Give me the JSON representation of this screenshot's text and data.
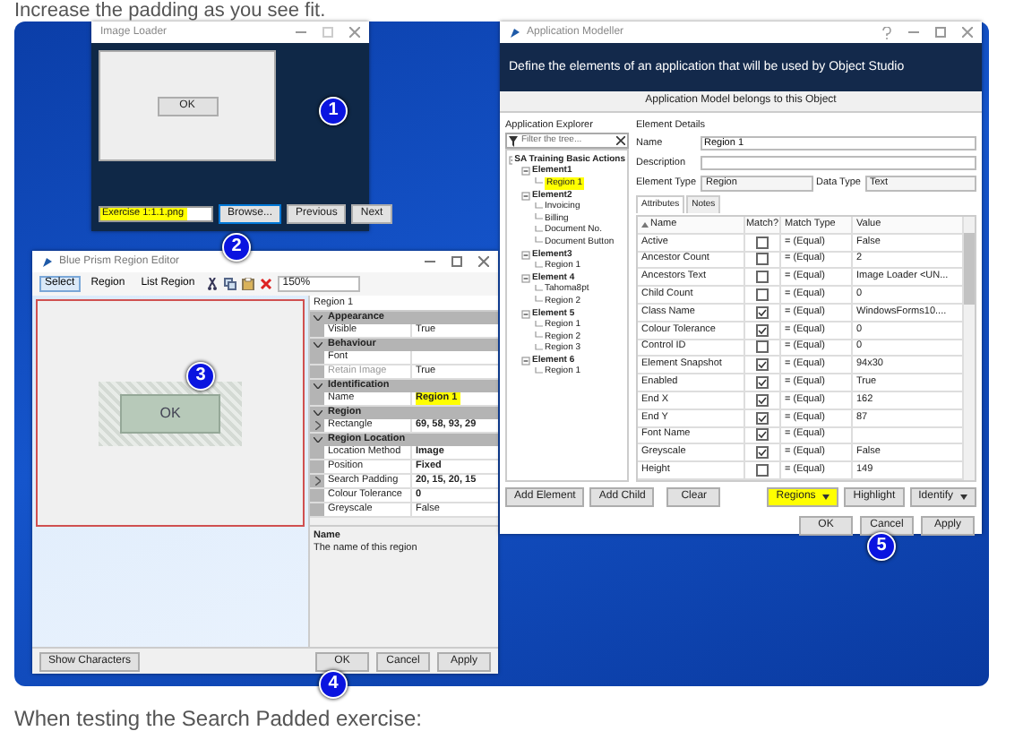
{
  "intro": "Increase the padding as you see fit.",
  "image_loader": {
    "title": "Image Loader",
    "preview_button": "OK",
    "file_field": {
      "value": "Exercise 1:1.1.png",
      "highlighted": true
    },
    "buttons": [
      {
        "label": "Browse...",
        "focused": true
      },
      {
        "label": "Previous",
        "focused": false
      },
      {
        "label": "Next",
        "focused": false
      }
    ]
  },
  "region_editor": {
    "title": "Blue Prism Region Editor",
    "toolbar": [
      {
        "label": "Select",
        "selected": true
      },
      {
        "label": "Region",
        "selected": false
      },
      {
        "label": "List Region",
        "selected": false
      }
    ],
    "zoom": "150%",
    "canvas_button": "OK",
    "object_select": "Region 1",
    "properties": [
      {
        "category": "Appearance",
        "rows": [
          {
            "name": "Visible",
            "value": "True",
            "bold": false,
            "highlighted": false,
            "disabled": false,
            "expandable": false
          }
        ]
      },
      {
        "category": "Behaviour",
        "rows": [
          {
            "name": "Font",
            "disabled": false,
            "expandable": false
          },
          {
            "name": "Retain Image",
            "value": "True",
            "bold": false,
            "highlighted": false,
            "disabled": true,
            "expandable": false
          }
        ]
      },
      {
        "category": "Identification",
        "rows": [
          {
            "name": "Name",
            "value": "Region 1",
            "bold": true,
            "highlighted": true,
            "disabled": false,
            "expandable": false
          }
        ]
      },
      {
        "category": "Region",
        "rows": [
          {
            "name": "Rectangle",
            "value": "69, 58, 93, 29",
            "bold": true,
            "highlighted": false,
            "disabled": false,
            "expandable": true
          }
        ]
      },
      {
        "category": "Region Location",
        "rows": [
          {
            "name": "Location Method",
            "value": "Image",
            "bold": true,
            "highlighted": false,
            "disabled": false,
            "expandable": false
          },
          {
            "name": "Position",
            "value": "Fixed",
            "bold": true,
            "highlighted": false,
            "disabled": false,
            "expandable": false
          },
          {
            "name": "Search Padding",
            "value": "20, 15, 20, 15",
            "bold": true,
            "highlighted": false,
            "disabled": false,
            "expandable": true
          },
          {
            "name": "Colour Tolerance",
            "value": "0",
            "bold": true,
            "highlighted": false,
            "disabled": false,
            "expandable": false
          },
          {
            "name": "Greyscale",
            "value": "False",
            "bold": false,
            "highlighted": false,
            "disabled": false,
            "expandable": false
          }
        ]
      }
    ],
    "help_title": "Name",
    "help_text": "The name of this region",
    "show_characters": "Show Characters",
    "buttons": [
      "OK",
      "Cancel",
      "Apply"
    ]
  },
  "modeller": {
    "title": "Application Modeller",
    "header": "Define the elements of an application that will be used by Object Studio",
    "strip": "Application Model belongs to this Object",
    "explorer_label": "Application Explorer",
    "filter_placeholder": "Filter the tree...",
    "tree": [
      {
        "label": "SA Training Basic Actions",
        "expanded": true,
        "selected": false,
        "children": [
          {
            "label": "Element1",
            "expanded": true,
            "selected": false,
            "children": [
              {
                "label": "Region 1",
                "selected": true
              }
            ]
          },
          {
            "label": "Element2",
            "expanded": true,
            "selected": false,
            "children": [
              {
                "label": "Invoicing",
                "selected": false
              },
              {
                "label": "Billing",
                "selected": false
              },
              {
                "label": "Document No.",
                "selected": false
              },
              {
                "label": "Document Button",
                "selected": false
              }
            ]
          },
          {
            "label": "Element3",
            "expanded": true,
            "selected": false,
            "children": [
              {
                "label": "Region 1",
                "selected": false
              }
            ]
          },
          {
            "label": "Element 4",
            "expanded": true,
            "selected": false,
            "children": [
              {
                "label": "Tahoma8pt",
                "selected": false
              },
              {
                "label": "Region 2",
                "selected": false
              }
            ]
          },
          {
            "label": "Element 5",
            "expanded": true,
            "selected": false,
            "children": [
              {
                "label": "Region 1",
                "selected": false
              },
              {
                "label": "Region 2",
                "selected": false
              },
              {
                "label": "Region 3",
                "selected": false
              }
            ]
          },
          {
            "label": "Element 6",
            "expanded": true,
            "selected": false,
            "children": [
              {
                "label": "Region 1",
                "selected": false
              }
            ]
          }
        ]
      }
    ],
    "details_label": "Element Details",
    "fields": [
      {
        "label": "Name",
        "value": "Region 1"
      },
      {
        "label": "Description"
      }
    ],
    "element_type": {
      "label": "Element Type",
      "value": "Region"
    },
    "data_type": {
      "label": "Data Type",
      "value": "Text"
    },
    "tabs": [
      {
        "label": "Attributes",
        "selected": true
      },
      {
        "label": "Notes",
        "selected": false
      }
    ],
    "columns": [
      "Name",
      "Match?",
      "Match Type",
      "Value"
    ],
    "rows": [
      {
        "name": "Active",
        "match": false,
        "match_type": "= (Equal)",
        "value": "False"
      },
      {
        "name": "Ancestor Count",
        "match": false,
        "match_type": "= (Equal)",
        "value": "2"
      },
      {
        "name": "Ancestors Text",
        "match": false,
        "match_type": "= (Equal)",
        "value": "Image Loader <UN..."
      },
      {
        "name": "Child Count",
        "match": false,
        "match_type": "= (Equal)",
        "value": "0"
      },
      {
        "name": "Class Name",
        "match": true,
        "match_type": "= (Equal)",
        "value": "WindowsForms10...."
      },
      {
        "name": "Colour Tolerance",
        "match": true,
        "match_type": "= (Equal)",
        "value": "0"
      },
      {
        "name": "Control ID",
        "match": false,
        "match_type": "= (Equal)",
        "value": "0"
      },
      {
        "name": "Element Snapshot",
        "match": true,
        "match_type": "= (Equal)",
        "value": "94x30"
      },
      {
        "name": "Enabled",
        "match": true,
        "match_type": "= (Equal)",
        "value": "True"
      },
      {
        "name": "End X",
        "match": true,
        "match_type": "= (Equal)",
        "value": "162"
      },
      {
        "name": "End Y",
        "match": true,
        "match_type": "= (Equal)",
        "value": "87"
      },
      {
        "name": "Font Name",
        "match": true,
        "match_type": "= (Equal)"
      },
      {
        "name": "Greyscale",
        "match": true,
        "match_type": "= (Equal)",
        "value": "False"
      },
      {
        "name": "Height",
        "match": false,
        "match_type": "= (Equal)",
        "value": "149"
      }
    ],
    "left_buttons": [
      "Add Element",
      "Add Child"
    ],
    "clear": "Clear",
    "action_buttons": [
      {
        "label": "Regions",
        "highlighted": true,
        "dropdown": true
      },
      {
        "label": "Highlight",
        "highlighted": false,
        "dropdown": false
      },
      {
        "label": "Identify",
        "highlighted": false,
        "dropdown": true
      }
    ],
    "buttons": [
      "OK",
      "Cancel",
      "Apply"
    ]
  },
  "badges": [
    "1",
    "2",
    "3",
    "4",
    "5"
  ],
  "outro": "When testing the Search Padded exercise:"
}
